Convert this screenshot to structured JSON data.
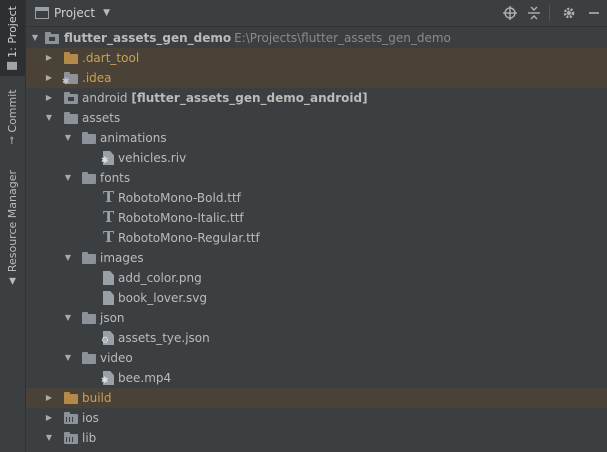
{
  "tool_strip": {
    "project": "1: Project",
    "commit": "Commit",
    "resource_manager": "Resource Manager"
  },
  "header": {
    "title": "Project"
  },
  "tree": [
    {
      "label": "flutter_assets_gen_demo",
      "path": "E:\\Projects\\flutter_assets_gen_demo"
    },
    {
      "label": ".dart_tool"
    },
    {
      "label": ".idea"
    },
    {
      "label": "android",
      "suffix": "[flutter_assets_gen_demo_android]"
    },
    {
      "label": "assets"
    },
    {
      "label": "animations"
    },
    {
      "label": "vehicles.riv"
    },
    {
      "label": "fonts"
    },
    {
      "label": "RobotoMono-Bold.ttf"
    },
    {
      "label": "RobotoMono-Italic.ttf"
    },
    {
      "label": "RobotoMono-Regular.ttf"
    },
    {
      "label": "images"
    },
    {
      "label": "add_color.png"
    },
    {
      "label": "book_lover.svg"
    },
    {
      "label": "json"
    },
    {
      "label": "assets_tye.json"
    },
    {
      "label": "video"
    },
    {
      "label": "bee.mp4"
    },
    {
      "label": "build"
    },
    {
      "label": "ios"
    },
    {
      "label": "lib"
    }
  ]
}
